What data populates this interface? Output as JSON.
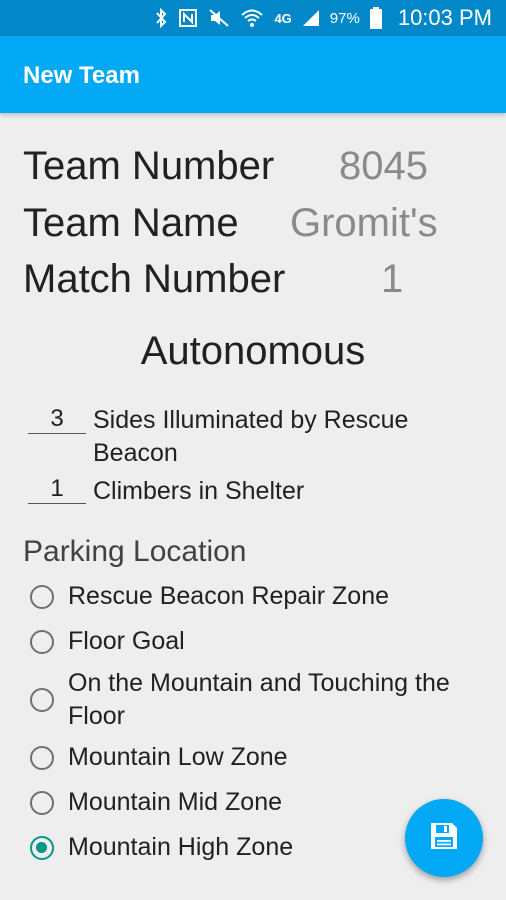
{
  "status_bar": {
    "battery_percent": "97%",
    "time": "10:03 PM",
    "network_label": "4G",
    "icons": [
      "bluetooth-icon",
      "nfc-icon",
      "mute-icon",
      "wifi-icon",
      "cellular-signal-icon",
      "battery-icon"
    ]
  },
  "app_bar": {
    "title": "New Team"
  },
  "team_info": {
    "team_number_label": "Team Number",
    "team_number_value": "8045",
    "team_name_label": "Team Name",
    "team_name_value": "Gromit's",
    "match_number_label": "Match Number",
    "match_number_value": "1"
  },
  "autonomous": {
    "title": "Autonomous",
    "counters": [
      {
        "value": "3",
        "label": "Sides Illuminated by Rescue Beacon"
      },
      {
        "value": "1",
        "label": "Climbers in Shelter"
      }
    ]
  },
  "parking": {
    "label": "Parking Location",
    "options": [
      {
        "label": "Rescue Beacon Repair Zone",
        "selected": false
      },
      {
        "label": "Floor Goal",
        "selected": false
      },
      {
        "label": "On the Mountain and Touching the Floor",
        "selected": false
      },
      {
        "label": "Mountain Low Zone",
        "selected": false
      },
      {
        "label": "Mountain Mid Zone",
        "selected": false
      },
      {
        "label": "Mountain High Zone",
        "selected": true
      }
    ]
  },
  "fab": {
    "icon": "save-icon"
  },
  "colors": {
    "app_bar": "#03a9f4",
    "status_bar": "#0288c9",
    "radio_checked": "#009688"
  }
}
